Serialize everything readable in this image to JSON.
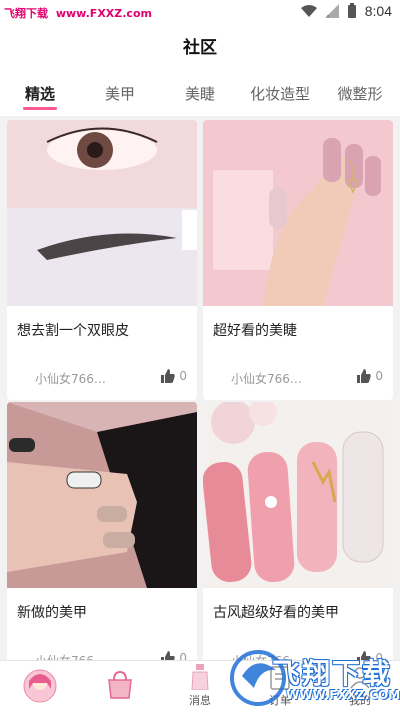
{
  "status_bar": {
    "site_name": "飞翔下载",
    "site_url": "www.FXXZ.com",
    "time": "8:04"
  },
  "header": {
    "title": "社区"
  },
  "tabs": [
    {
      "label": "精选",
      "active": true
    },
    {
      "label": "美甲",
      "active": false
    },
    {
      "label": "美睫",
      "active": false
    },
    {
      "label": "化妆造型",
      "active": false
    },
    {
      "label": "微整形",
      "active": false
    }
  ],
  "cards": [
    {
      "title": "想去割一个双眼皮",
      "author": "小仙女766…",
      "likes": "0",
      "image": "eye and eyebrow photo"
    },
    {
      "title": "超好看的美睫",
      "author": "小仙女766…",
      "likes": "0",
      "image": "pink nails photo"
    },
    {
      "title": "新做的美甲",
      "author": "小仙女766…",
      "likes": "0",
      "image": "hand with nails on phone"
    },
    {
      "title": "古风超级好看的美甲",
      "author": "小仙女766…",
      "likes": "0",
      "image": "decorated pink nails"
    }
  ],
  "bottom_nav": [
    {
      "label": "",
      "icon": "avatar-icon"
    },
    {
      "label": "",
      "icon": "bag-icon"
    },
    {
      "label": "消息",
      "icon": "bottle-icon"
    },
    {
      "label": "订单",
      "icon": "order-icon"
    },
    {
      "label": "我的",
      "icon": "profile-icon"
    }
  ],
  "watermark": {
    "brand": "飞翔下载",
    "url": "WWW.FXXZ.COM"
  },
  "colors": {
    "accent": "#ff5a91",
    "watermark": "#e0006e"
  }
}
